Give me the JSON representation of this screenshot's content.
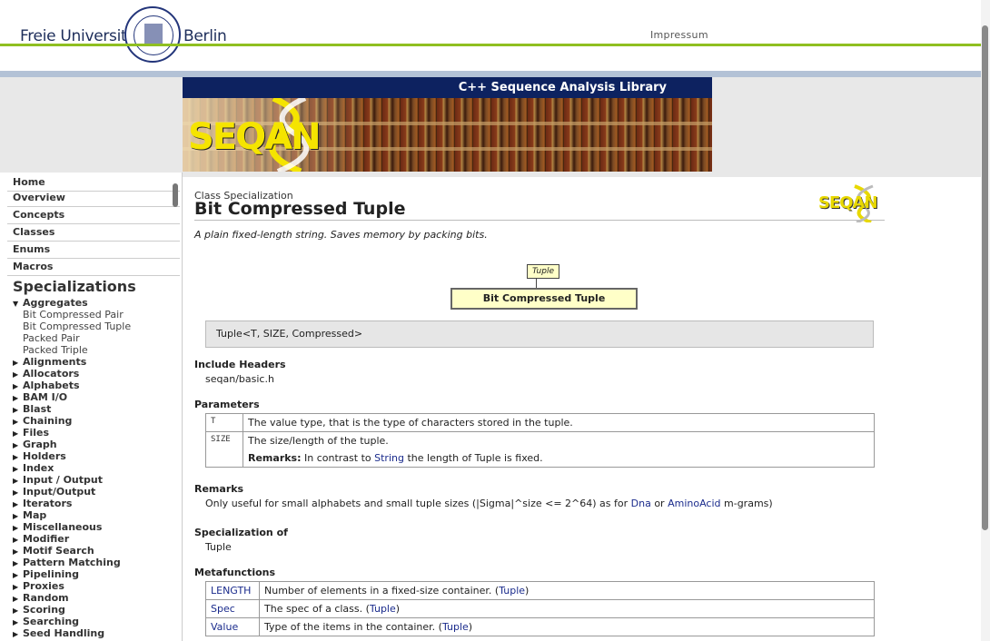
{
  "header": {
    "university_left": "Freie Universität",
    "university_right": "Berlin",
    "impressum": "Impressum"
  },
  "banner": {
    "title": "C++ Sequence Analysis Library",
    "logo": "SEQAN"
  },
  "sidebar": {
    "nav": [
      "Home",
      "Overview",
      "Concepts",
      "Classes",
      "Enums",
      "Macros"
    ],
    "section_title": "Specializations",
    "expanded_group": "Aggregates",
    "expanded_items": [
      "Bit Compressed Pair",
      "Bit Compressed Tuple",
      "Packed Pair",
      "Packed Triple"
    ],
    "groups": [
      "Alignments",
      "Allocators",
      "Alphabets",
      "BAM I/O",
      "Blast",
      "Chaining",
      "Files",
      "Graph",
      "Holders",
      "Index",
      "Input / Output",
      "Input/Output",
      "Iterators",
      "Map",
      "Miscellaneous",
      "Modifier",
      "Motif Search",
      "Pattern Matching",
      "Pipelining",
      "Proxies",
      "Random",
      "Scoring",
      "Searching",
      "Seed Handling"
    ]
  },
  "main": {
    "kind": "Class Specialization",
    "title": "Bit Compressed Tuple",
    "logo": "SEQAN",
    "description": "A plain fixed-length string. Saves memory by packing bits.",
    "diagram": {
      "parent": "Tuple",
      "current": "Bit Compressed Tuple"
    },
    "signature": "Tuple<T, SIZE, Compressed>",
    "include_heading": "Include Headers",
    "include_file": "seqan/basic.h",
    "params_heading": "Parameters",
    "params": [
      {
        "name": "T",
        "desc": "The value type, that is the type of characters stored in the tuple."
      },
      {
        "name": "SIZE",
        "desc": "The size/length of the tuple.",
        "remarks_label": "Remarks:",
        "remarks_pre": "In contrast to",
        "remarks_link": "String",
        "remarks_post": "the length of Tuple is fixed."
      }
    ],
    "remarks_heading": "Remarks",
    "remarks_pre": "Only useful for small alphabets and small tuple sizes (|Sigma|^size <= 2^64) as for",
    "remarks_link1": "Dna",
    "remarks_mid": "or",
    "remarks_link2": "AminoAcid",
    "remarks_post": "m-grams)",
    "spec_heading": "Specialization of",
    "spec_link": "Tuple",
    "meta_heading": "Metafunctions",
    "metafunctions": [
      {
        "name": "LENGTH",
        "desc": "Number of elements in a fixed-size container.",
        "ref": "Tuple"
      },
      {
        "name": "Spec",
        "desc": "The spec of a class.",
        "ref": "Tuple"
      },
      {
        "name": "Value",
        "desc": "Type of the items in the container.",
        "ref": "Tuple"
      }
    ]
  },
  "colors": {
    "accent_green": "#8fbf21",
    "banner_blue": "#0d2260",
    "link": "#1a2b8c"
  }
}
